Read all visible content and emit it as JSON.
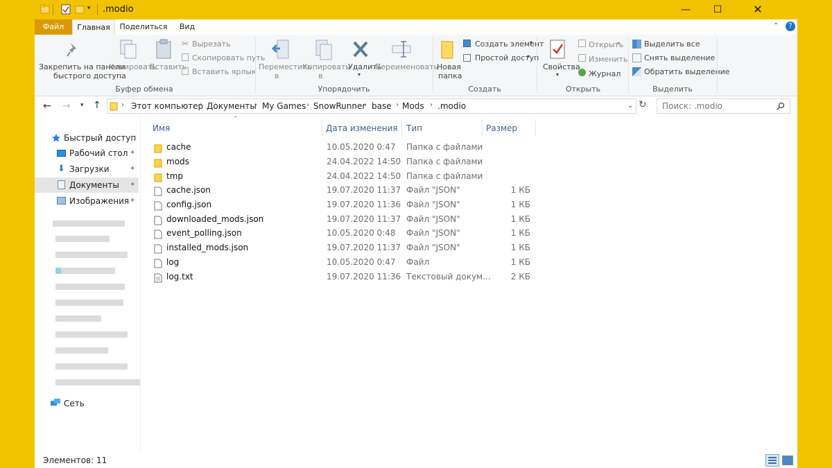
{
  "window": {
    "title": ".modio"
  },
  "tabs": {
    "file": "Файл",
    "home": "Главная",
    "share": "Поделиться",
    "view": "Вид"
  },
  "ribbon": {
    "clipboard": {
      "pin_line1": "Закрепить на панели",
      "pin_line2": "быстрого доступа",
      "copy": "Копировать",
      "paste": "Вставить",
      "cut": "Вырезать",
      "copy_path": "Скопировать путь",
      "paste_shortcut": "Вставить ярлык",
      "group": "Буфер обмена"
    },
    "organize": {
      "move_line1": "Переместить",
      "move_line2": "в",
      "copy_line1": "Копировать",
      "copy_line2": "в",
      "delete": "Удалить",
      "rename": "Переименовать",
      "group": "Упорядочить"
    },
    "create": {
      "new_folder_line1": "Новая",
      "new_folder_line2": "папка",
      "new_item": "Создать элемент",
      "easy_access": "Простой доступ",
      "group": "Создать"
    },
    "open": {
      "properties": "Свойства",
      "open": "Открыть",
      "edit": "Изменить",
      "history": "Журнал",
      "group": "Открыть"
    },
    "select": {
      "select_all": "Выделить все",
      "select_none": "Снять выделение",
      "invert": "Обратить выделение",
      "group": "Выделить"
    }
  },
  "address": {
    "crumbs": [
      "Этот компьютер",
      "Документы",
      "My Games",
      "SnowRunner",
      "base",
      "Mods",
      ".modio"
    ],
    "search_placeholder": "Поиск: .modio"
  },
  "nav": {
    "quick_access": "Быстрый доступ",
    "items": [
      "Рабочий стол",
      "Загрузки",
      "Документы",
      "Изображения"
    ],
    "network": "Сеть"
  },
  "columns": {
    "name": "Имя",
    "date": "Дата изменения",
    "type": "Тип",
    "size": "Размер"
  },
  "files": [
    {
      "name": "cache",
      "date": "10.05.2020 0:47",
      "type": "Папка с файлами",
      "size": "",
      "kind": "folder"
    },
    {
      "name": "mods",
      "date": "24.04.2022 14:50",
      "type": "Папка с файлами",
      "size": "",
      "kind": "folder"
    },
    {
      "name": "tmp",
      "date": "24.04.2022 14:50",
      "type": "Папка с файлами",
      "size": "",
      "kind": "folder"
    },
    {
      "name": "cache.json",
      "date": "19.07.2020 11:37",
      "type": "Файл \"JSON\"",
      "size": "1 КБ",
      "kind": "file"
    },
    {
      "name": "config.json",
      "date": "19.07.2020 11:36",
      "type": "Файл \"JSON\"",
      "size": "1 КБ",
      "kind": "file"
    },
    {
      "name": "downloaded_mods.json",
      "date": "19.07.2020 11:37",
      "type": "Файл \"JSON\"",
      "size": "1 КБ",
      "kind": "file"
    },
    {
      "name": "event_polling.json",
      "date": "10.05.2020 0:48",
      "type": "Файл \"JSON\"",
      "size": "1 КБ",
      "kind": "file"
    },
    {
      "name": "installed_mods.json",
      "date": "19.07.2020 11:37",
      "type": "Файл \"JSON\"",
      "size": "1 КБ",
      "kind": "file"
    },
    {
      "name": "log",
      "date": "10.05.2020 0:47",
      "type": "Файл",
      "size": "1 КБ",
      "kind": "file"
    },
    {
      "name": "log.txt",
      "date": "19.07.2020 11:36",
      "type": "Текстовый докум...",
      "size": "2 КБ",
      "kind": "text"
    }
  ],
  "status": {
    "count": "Элементов: 11"
  },
  "colors": {
    "accent": "#f2c300",
    "file_tab": "#d99a08",
    "selected_nav": "#e5e5e5",
    "header_text": "#3a5f8c"
  }
}
